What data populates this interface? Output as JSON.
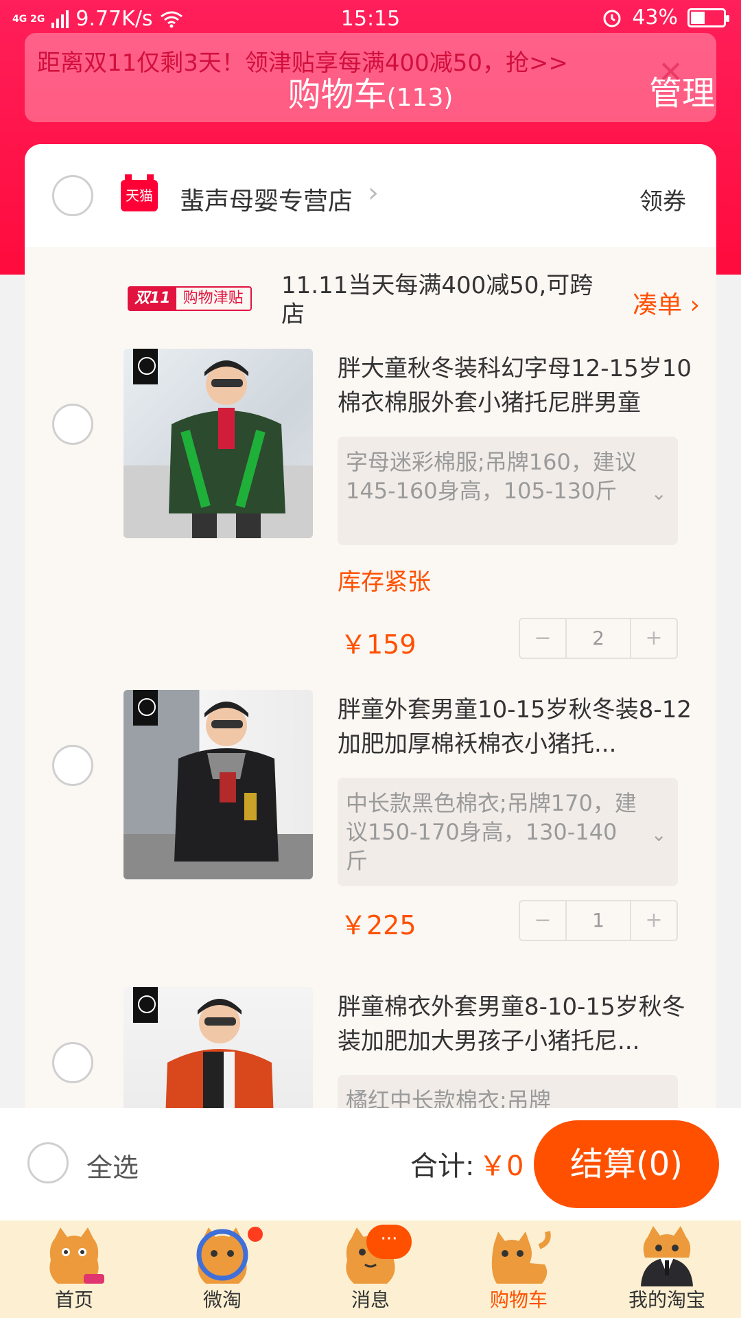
{
  "status_bar": {
    "network": "4G 2G",
    "speed": "9.77K/s",
    "time": "15:15",
    "battery": "43%",
    "battery_level": 0.43
  },
  "header": {
    "title": "购物车",
    "count": "(113)",
    "manage": "管理"
  },
  "banner": {
    "text": "距离双11仅剩3天！领津贴享每满400减50，抢>>",
    "close": "✕"
  },
  "shop": {
    "name": "蜚声母婴专营店",
    "badge": "天猫",
    "coupon": "领券"
  },
  "promo": {
    "tag_a": "双11",
    "tag_b": "购物津贴",
    "text": "11.11当天每满400减50,可跨店",
    "link": "凑单"
  },
  "items": [
    {
      "title": "胖大童秋冬装科幻字母12-15岁10棉衣棉服外套小猪托尼胖男童",
      "sku": "字母迷彩棉服;吊牌160，建议145-160身高，105-130斤",
      "stock": "库存紧张",
      "price": "￥159",
      "qty": "2"
    },
    {
      "title": "胖童外套男童10-15岁秋冬装8-12加肥加厚棉袄棉衣小猪托...",
      "sku": "中长款黑色棉衣;吊牌170，建议150-170身高，130-140斤",
      "price": "￥225",
      "qty": "1"
    },
    {
      "title": "胖童棉衣外套男童8-10-15岁秋冬装加肥加大男孩子小猪托尼...",
      "sku": "橘红中长款棉衣;吊牌"
    }
  ],
  "footer": {
    "select_all": "全选",
    "total_label": "合计:",
    "total_value": "￥0",
    "checkout": "结算(0)"
  },
  "tabs": [
    {
      "label": "首页",
      "icon": "cat-home-icon"
    },
    {
      "label": "微淘",
      "icon": "cat-weitao-icon"
    },
    {
      "label": "消息",
      "icon": "cat-message-icon",
      "bubble": "···"
    },
    {
      "label": "购物车",
      "icon": "cat-cart-icon",
      "active": true
    },
    {
      "label": "我的淘宝",
      "icon": "cat-profile-icon"
    }
  ],
  "colors": {
    "brand_red": "#ff1f5a",
    "accent_orange": "#ff5000",
    "tabbar_bg": "#fdf0d2"
  }
}
